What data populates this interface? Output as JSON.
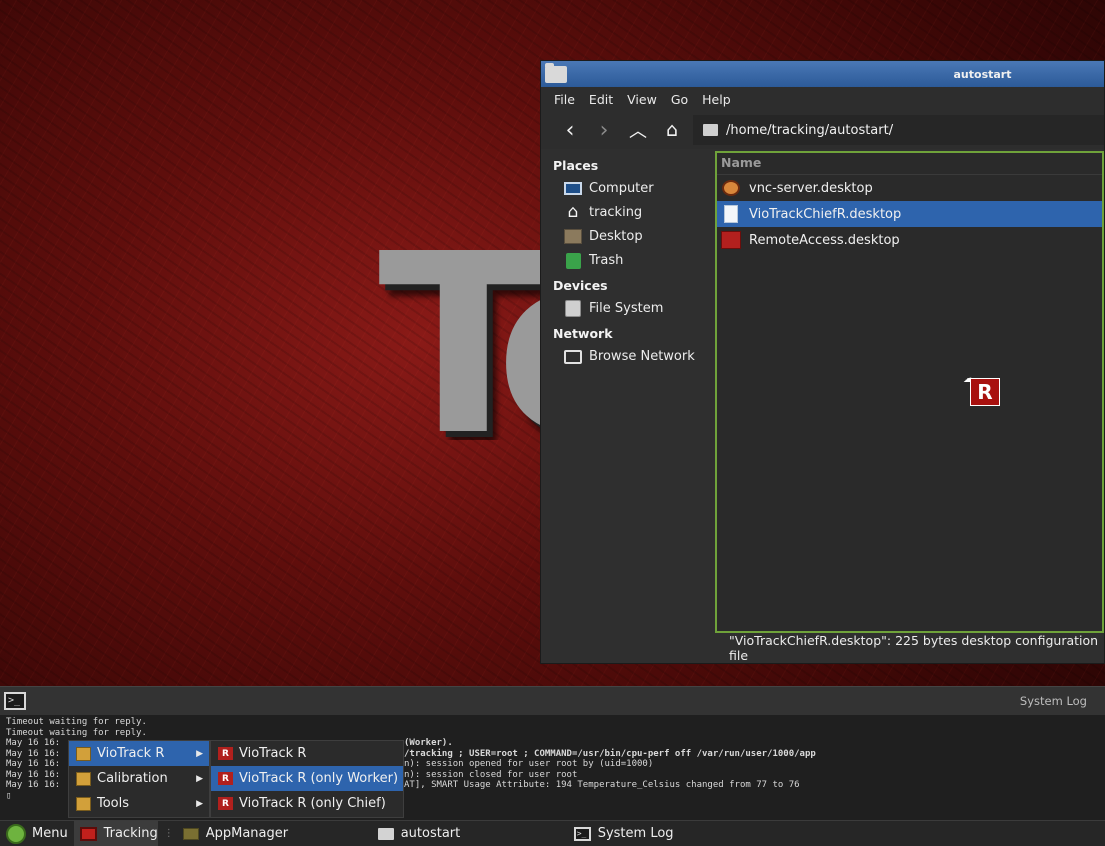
{
  "wallpaper": {
    "logo_text": "Te"
  },
  "file_manager": {
    "title": "autostart",
    "menu": [
      "File",
      "Edit",
      "View",
      "Go",
      "Help"
    ],
    "path": "/home/tracking/autostart/",
    "sidebar": {
      "places_heading": "Places",
      "places": [
        "Computer",
        "tracking",
        "Desktop",
        "Trash"
      ],
      "devices_heading": "Devices",
      "devices": [
        "File System"
      ],
      "network_heading": "Network",
      "network": [
        "Browse Network"
      ]
    },
    "column_name": "Name",
    "files": [
      {
        "name": "vnc-server.desktop",
        "icon": "vnc-icon",
        "selected": false
      },
      {
        "name": "VioTrackChiefR.desktop",
        "icon": "document-icon",
        "selected": true
      },
      {
        "name": "RemoteAccess.desktop",
        "icon": "remote-access-icon",
        "selected": false
      }
    ],
    "drag_icon_label": "R",
    "status": "\"VioTrackChiefR.desktop\": 225 bytes desktop configuration file"
  },
  "system_log": {
    "title": "System Log",
    "lines": [
      "Timeout waiting for reply.",
      "Timeout waiting for reply.",
      "May 16 16:",
      "May 16 16:",
      "May 16 16:",
      "May 16 16:",
      "May 16 16:"
    ],
    "right_fragments": [
      "(Worker).",
      "/tracking ; USER=root ; COMMAND=/usr/bin/cpu-perf off /var/run/user/1000/app",
      "n): session opened for user root by (uid=1000)",
      "n): session closed for user root",
      "AT], SMART Usage Attribute: 194 Temperature_Celsius changed from 77 to 76"
    ],
    "cursor": "▯"
  },
  "start_menu": {
    "items": [
      "VioTrack R",
      "Calibration",
      "Tools"
    ],
    "submenu": [
      "VioTrack R",
      "VioTrack R (only Worker)",
      "VioTrack R (only Chief)"
    ]
  },
  "taskbar": {
    "menu_label": "Menu",
    "items": [
      "Tracking",
      "AppManager",
      "autostart",
      "System Log"
    ]
  }
}
